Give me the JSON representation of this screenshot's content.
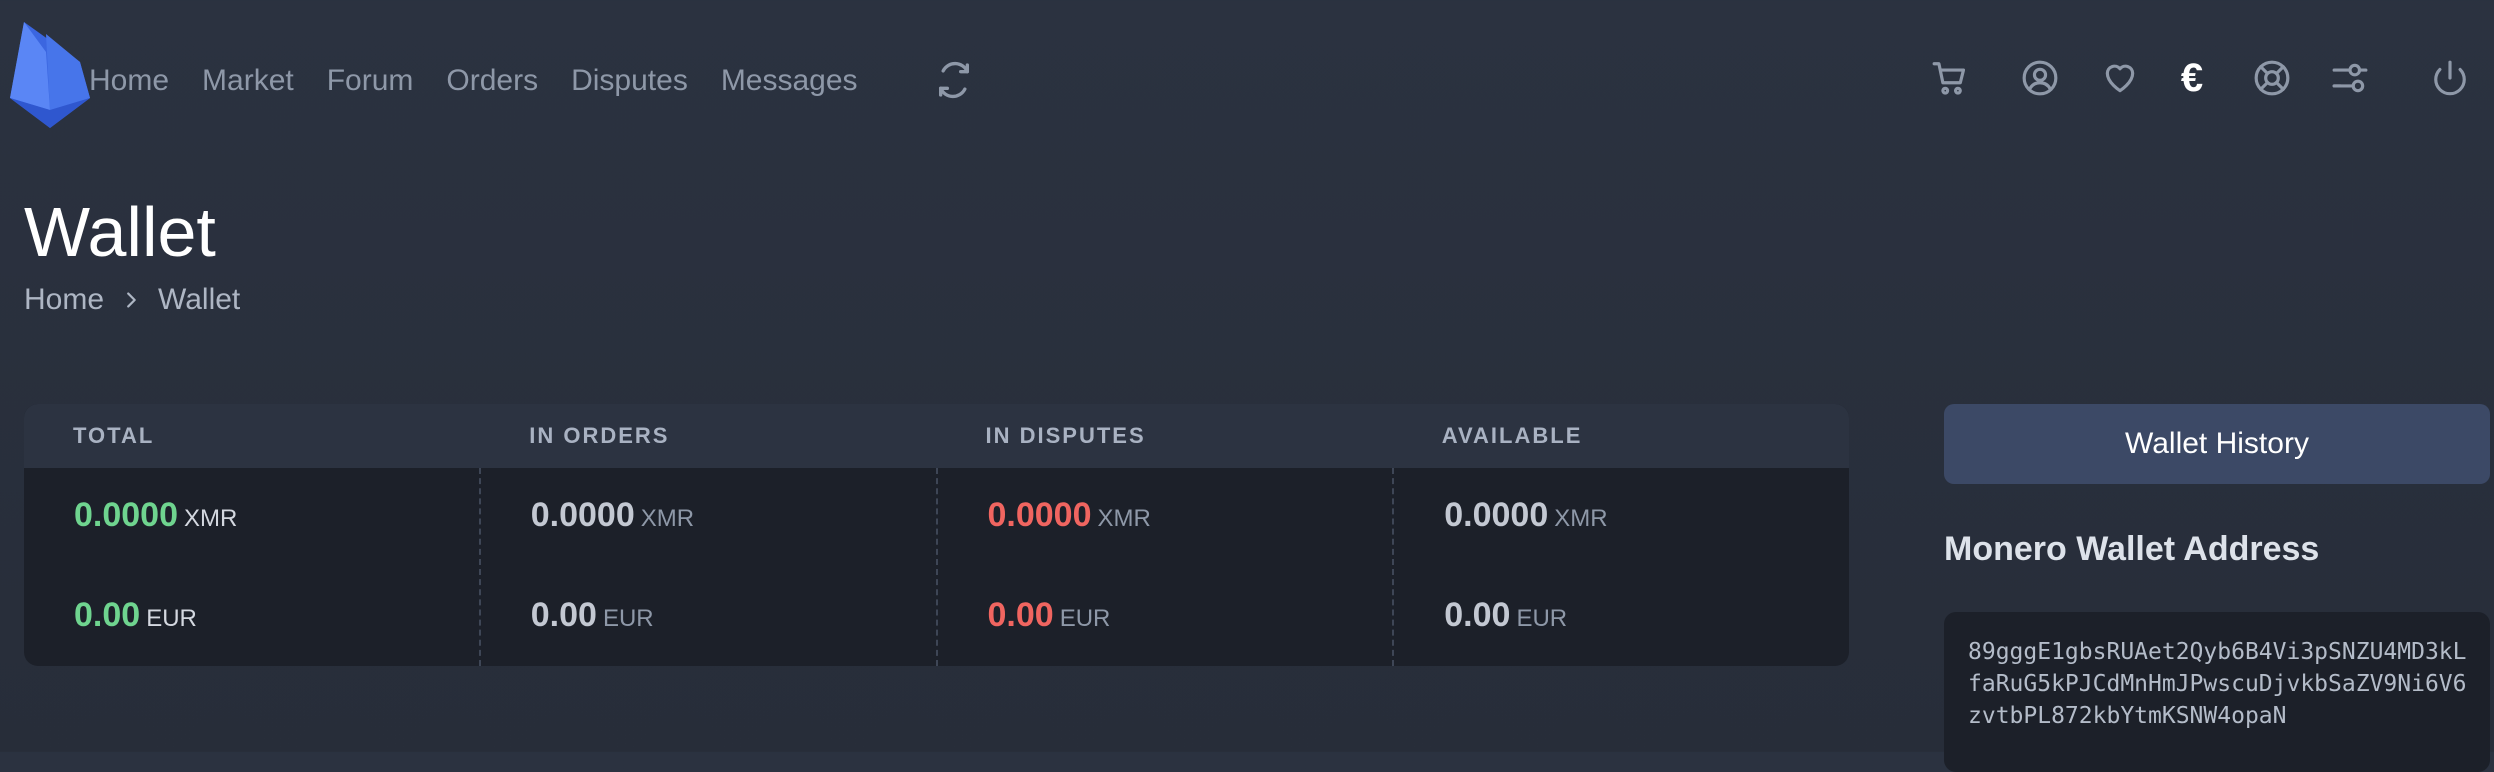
{
  "nav": {
    "items": [
      {
        "label": "Home"
      },
      {
        "label": "Market"
      },
      {
        "label": "Forum"
      },
      {
        "label": "Orders"
      },
      {
        "label": "Disputes"
      },
      {
        "label": "Messages"
      }
    ],
    "refresh_icon": "refresh-icon",
    "right_icons": [
      "cart-icon",
      "user-icon",
      "heart-icon",
      "euro-icon",
      "support-icon",
      "settings-sliders-icon",
      "power-icon"
    ],
    "currency_symbol": "€"
  },
  "header": {
    "title": "Wallet",
    "breadcrumb": [
      "Home",
      "Wallet"
    ]
  },
  "balances": {
    "columns": [
      {
        "label": "TOTAL",
        "xmr": "0.0000",
        "xmr_unit": "XMR",
        "eur": "0.00",
        "eur_unit": "EUR",
        "color": "#6fd48f"
      },
      {
        "label": "IN ORDERS",
        "xmr": "0.0000",
        "xmr_unit": "XMR",
        "eur": "0.00",
        "eur_unit": "EUR",
        "color": "#c3c8d2"
      },
      {
        "label": "IN DISPUTES",
        "xmr": "0.0000",
        "xmr_unit": "XMR",
        "eur": "0.00",
        "eur_unit": "EUR",
        "color": "#f06560"
      },
      {
        "label": "AVAILABLE",
        "xmr": "0.0000",
        "xmr_unit": "XMR",
        "eur": "0.00",
        "eur_unit": "EUR",
        "color": "#c3c8d2"
      }
    ]
  },
  "sidebar": {
    "wallet_history_label": "Wallet History",
    "address_title": "Monero Wallet Address",
    "address": "89gggE1gbsRUAet2Qyb6B4Vi3pSNZU4MD3kLfaRuG5kPJCdMnHmJPwscuDjvkbSaZV9Ni6V6zvtbPL872kbYtmKSNW4opaN"
  },
  "colors": {
    "accent": "#3c4966",
    "positive": "#6fd48f",
    "negative": "#f06560",
    "logo": "#4f7cf0"
  }
}
